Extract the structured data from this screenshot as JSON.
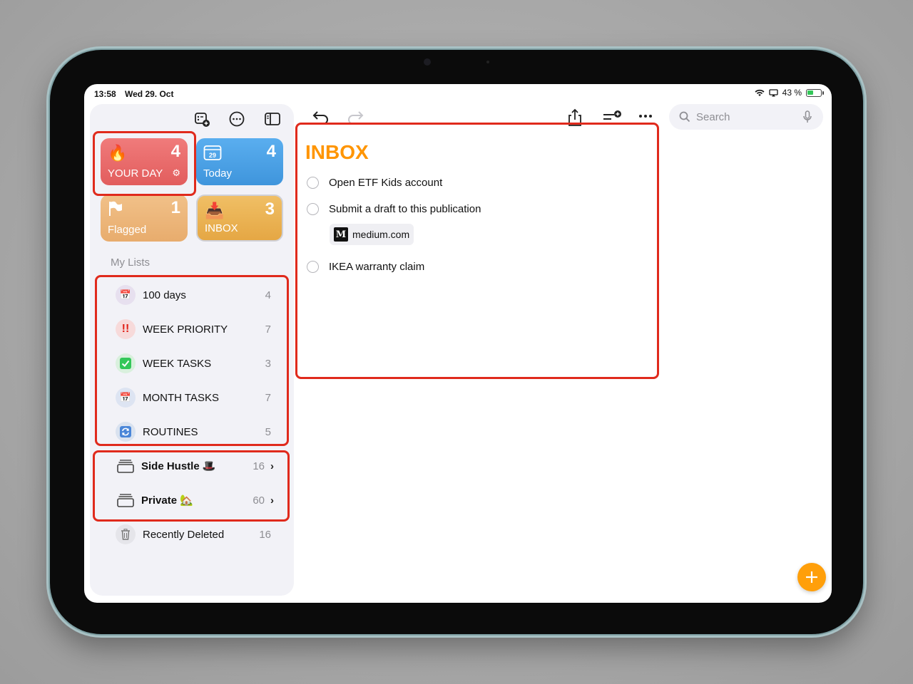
{
  "status_bar": {
    "time": "13:58",
    "date": "Wed 29. Oct",
    "battery": "43 %",
    "battery_level": 0.43
  },
  "smart_lists": [
    {
      "label": "YOUR DAY",
      "count": "4",
      "icon": "fire-icon",
      "color": "#e96a6a"
    },
    {
      "label": "Today",
      "count": "4",
      "icon": "calendar-icon",
      "calendar_day": "29",
      "color": "#4da3e6"
    },
    {
      "label": "Flagged",
      "count": "1",
      "icon": "flag-icon",
      "color": "#ecb77d"
    },
    {
      "label": "INBOX",
      "count": "3",
      "icon": "inbox-tray-icon",
      "color": "#ebb257"
    }
  ],
  "my_lists": {
    "title": "My Lists",
    "items": [
      {
        "label": "100 days",
        "count": "4",
        "icon": "calendar-icon"
      },
      {
        "label": "WEEK PRIORITY",
        "count": "7",
        "icon": "double-exclamation-icon"
      },
      {
        "label": "WEEK TASKS",
        "count": "3",
        "icon": "checkmark-box-icon"
      },
      {
        "label": "MONTH TASKS",
        "count": "7",
        "icon": "calendar-icon"
      },
      {
        "label": "ROUTINES",
        "count": "5",
        "icon": "repeat-icon"
      }
    ]
  },
  "groups": [
    {
      "label": "Side Hustle",
      "emoji": "🎩",
      "count": "16"
    },
    {
      "label": "Private",
      "emoji": "🏡",
      "count": "60"
    }
  ],
  "recently_deleted": {
    "label": "Recently Deleted",
    "count": "16"
  },
  "search": {
    "placeholder": "Search"
  },
  "main": {
    "title": "INBOX",
    "tasks": [
      {
        "text": "Open ETF Kids account"
      },
      {
        "text": "Submit a draft to this publication",
        "link": "medium.com",
        "link_logo": "M"
      },
      {
        "text": "IKEA warranty claim"
      }
    ]
  },
  "colors": {
    "accent": "#ff9500",
    "highlight": "#e02a1c"
  }
}
